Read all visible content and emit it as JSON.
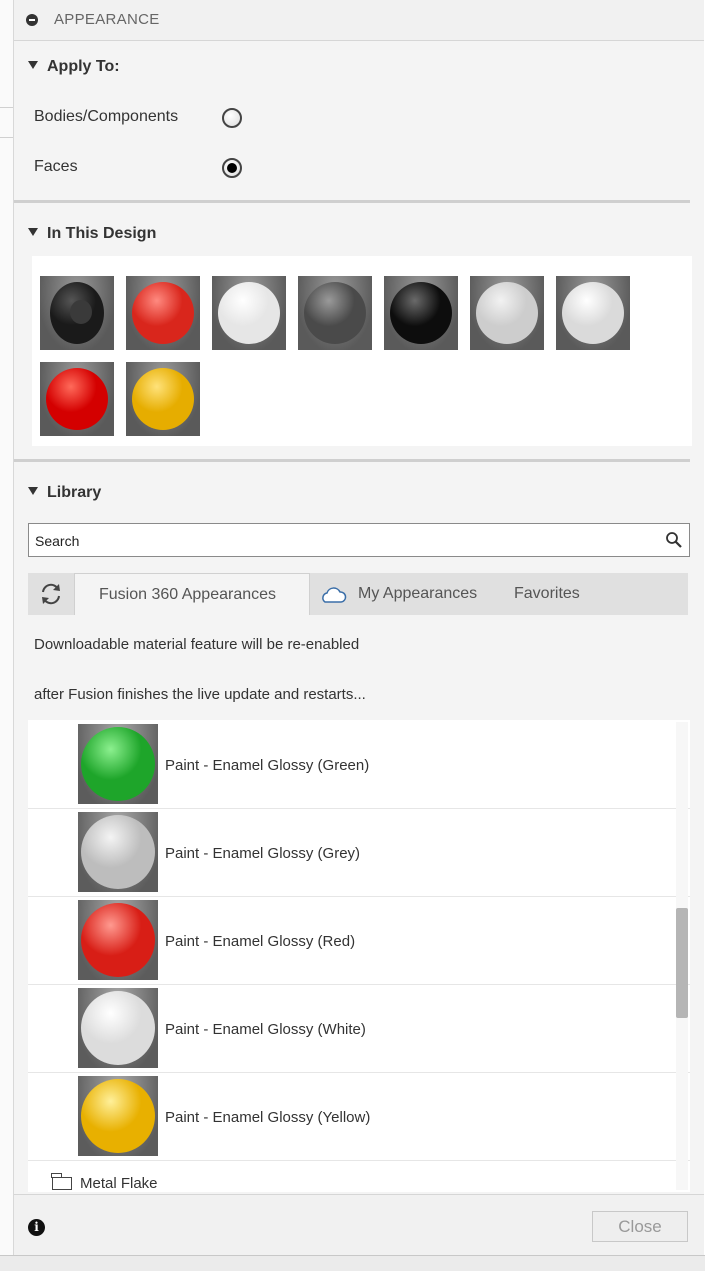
{
  "panel_title": "APPEARANCE",
  "apply_to": {
    "heading": "Apply To:",
    "options": [
      {
        "label": "Bodies/Components",
        "selected": false
      },
      {
        "label": "Faces",
        "selected": true
      }
    ]
  },
  "in_this_design": {
    "heading": "In This Design",
    "swatches": [
      {
        "name": "black-ring-swatch-icon",
        "color": "#1a1a1a",
        "highlight": "#555555"
      },
      {
        "name": "red-glossy-swatch-icon",
        "color": "#d9261c",
        "highlight": "#ff8a80"
      },
      {
        "name": "white-swatch-icon",
        "color": "#e6e6e6",
        "highlight": "#ffffff"
      },
      {
        "name": "dark-grey-glossy-swatch-icon",
        "color": "#4a4a4a",
        "highlight": "#9a9a9a"
      },
      {
        "name": "black-glossy-swatch-icon",
        "color": "#0d0d0d",
        "highlight": "#6a6a6a"
      },
      {
        "name": "light-grey-swatch-icon",
        "color": "#cdcdcd",
        "highlight": "#f2f2f2"
      },
      {
        "name": "white-matte-swatch-icon",
        "color": "#dadada",
        "highlight": "#ffffff"
      },
      {
        "name": "red-swatch-icon",
        "color": "#d40000",
        "highlight": "#ff6a5a"
      },
      {
        "name": "yellow-swatch-icon",
        "color": "#e6ad00",
        "highlight": "#ffe27a"
      }
    ]
  },
  "library": {
    "heading": "Library",
    "search_value": "Search",
    "tabs": [
      {
        "label": "Fusion 360 Appearances",
        "active": true
      },
      {
        "label": "My Appearances",
        "active": false
      },
      {
        "label": "Favorites",
        "active": false
      }
    ],
    "notice_line1": "Downloadable material feature will be re-enabled",
    "notice_line2": "after Fusion finishes the live update and restarts...",
    "items": [
      {
        "label": "Paint - Enamel Glossy (Green)",
        "color": "#1ea52a",
        "highlight": "#8cf08f"
      },
      {
        "label": "Paint - Enamel Glossy (Grey)",
        "color": "#bdbdbd",
        "highlight": "#f4f4f4"
      },
      {
        "label": "Paint - Enamel Glossy (Red)",
        "color": "#d81e16",
        "highlight": "#ff9a90"
      },
      {
        "label": "Paint - Enamel Glossy (White)",
        "color": "#dcdcdc",
        "highlight": "#ffffff"
      },
      {
        "label": "Paint - Enamel Glossy (Yellow)",
        "color": "#e8b000",
        "highlight": "#fff09a"
      }
    ],
    "folder_label": "Metal Flake"
  },
  "footer": {
    "close_label": "Close"
  }
}
